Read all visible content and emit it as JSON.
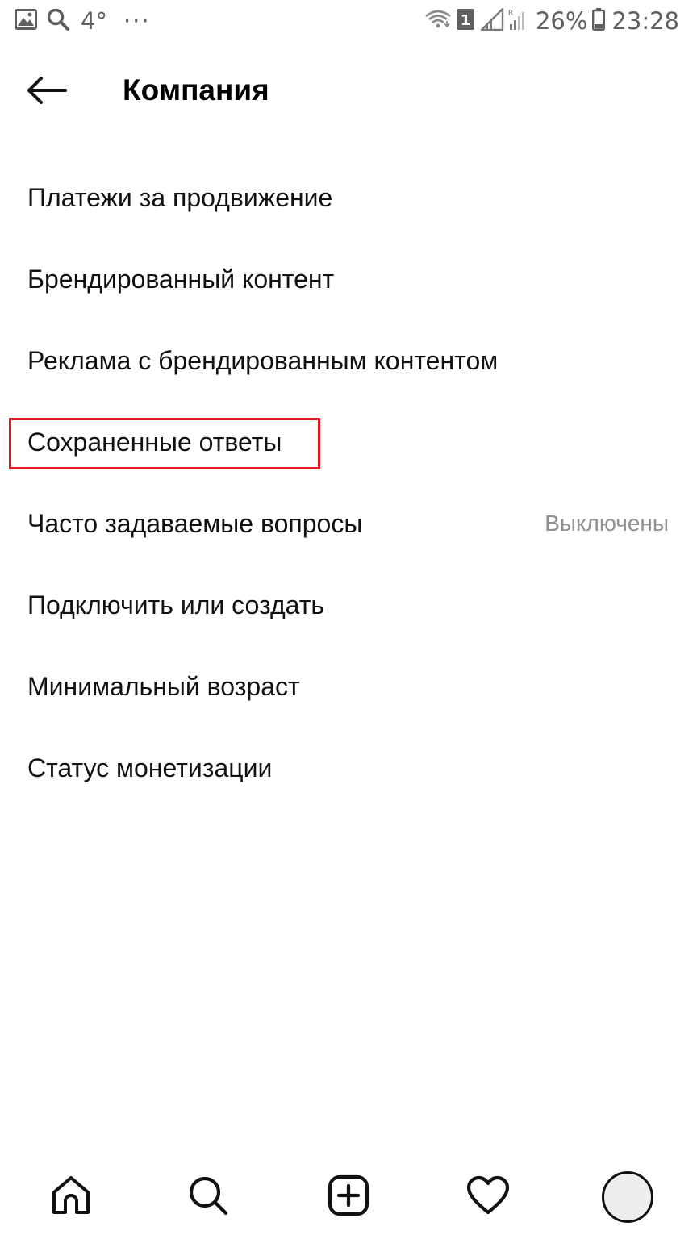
{
  "status_bar": {
    "temperature": "4°",
    "dots": "···",
    "sim_number": "1",
    "battery_percent": "26%",
    "time": "23:28",
    "left_icons": [
      "gallery-icon",
      "search-icon"
    ],
    "right_icons": [
      "wifi-icon",
      "sim-badge-icon",
      "signal-icon",
      "signal-roaming-icon",
      "battery-icon"
    ]
  },
  "header": {
    "back_icon": "arrow-left-icon",
    "title": "Компания"
  },
  "menu": {
    "items": [
      {
        "label": "Платежи за продвижение",
        "value": ""
      },
      {
        "label": "Брендированный контент",
        "value": ""
      },
      {
        "label": "Реклама с брендированным контентом",
        "value": ""
      },
      {
        "label": "Сохраненные ответы",
        "value": ""
      },
      {
        "label": "Часто задаваемые вопросы",
        "value": "Выключены"
      },
      {
        "label": "Подключить или создать",
        "value": ""
      },
      {
        "label": "Минимальный возраст",
        "value": ""
      },
      {
        "label": "Статус монетизации",
        "value": ""
      }
    ],
    "highlighted_index": 3,
    "highlight_color": "#e01b24"
  },
  "bottom_nav": {
    "items": [
      "home-icon",
      "search-icon",
      "add-post-icon",
      "activity-heart-icon",
      "profile-avatar"
    ]
  },
  "colors": {
    "background": "#ffffff",
    "text": "#111111",
    "secondary_text": "#909090",
    "status_text": "#5f5f5f"
  }
}
